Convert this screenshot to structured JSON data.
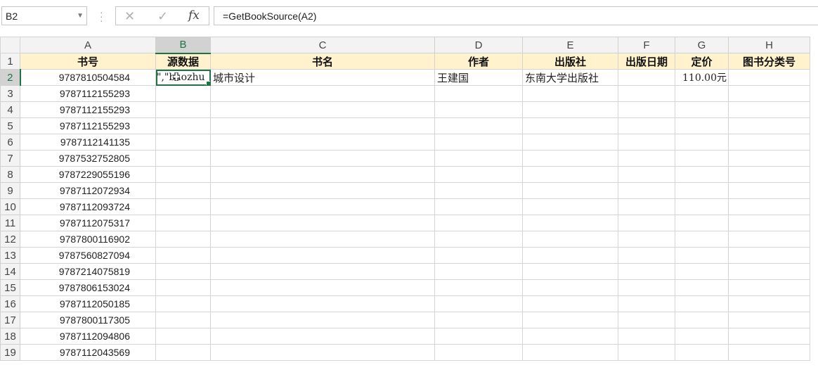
{
  "formula_bar": {
    "name_box": "B2",
    "cancel_icon": "✕",
    "enter_icon": "✓",
    "fx_label": "fx",
    "formula": "=GetBookSource(A2)"
  },
  "columns": [
    "A",
    "B",
    "C",
    "D",
    "E",
    "F",
    "G",
    "H"
  ],
  "headers": {
    "A": "书号",
    "B": "源数据",
    "C": "书名",
    "D": "作者",
    "E": "出版社",
    "F": "出版日期",
    "G": "定价",
    "H": "图书分类号"
  },
  "row2": {
    "B": "\",\"baozhu",
    "C": "城市设计",
    "D": "王建国",
    "E": "东南大学出版社",
    "G": "110.00元"
  },
  "row_numbers": [
    "1",
    "2",
    "3",
    "4",
    "5",
    "6",
    "7",
    "8",
    "9",
    "10",
    "11",
    "12",
    "13",
    "14",
    "15",
    "16",
    "17",
    "18",
    "19"
  ],
  "isbn": [
    "9787810504584",
    "9787112155293",
    "9787112155293",
    "9787112155293",
    "9787112141135",
    "9787532752805",
    "9787229055196",
    "9787112072934",
    "9787112093724",
    "9787112075317",
    "9787800116902",
    "9787560827094",
    "9787214075819",
    "9787806153024",
    "9787112050185",
    "9787800117305",
    "9787112094806",
    "9787112043569"
  ],
  "selection": {
    "active_column": "B",
    "active_row": "2",
    "accent_color": "#217346"
  },
  "header_fill": "#fff2cc"
}
